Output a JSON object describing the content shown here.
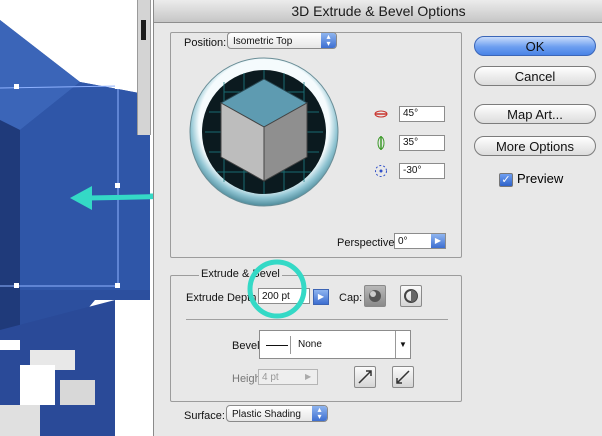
{
  "dialog": {
    "title": "3D Extrude & Bevel Options"
  },
  "position": {
    "label": "Position:",
    "preset": "Isometric Top",
    "x_rotation": "45°",
    "y_rotation": "35°",
    "z_rotation": "-30°",
    "perspective_label": "Perspective:",
    "perspective_value": "0°"
  },
  "extrude": {
    "group_label": "Extrude & Bevel",
    "depth_label": "Extrude Depth",
    "depth_value": "200 pt",
    "cap_label": "Cap:",
    "bevel_label": "Bevel:",
    "bevel_value": "None",
    "height_label": "Height:",
    "height_value": "4 pt"
  },
  "surface": {
    "label": "Surface:",
    "value": "Plastic Shading"
  },
  "buttons": {
    "ok": "OK",
    "cancel": "Cancel",
    "map_art": "Map Art...",
    "more_options": "More Options"
  },
  "preview": {
    "label": "Preview",
    "checked": true,
    "check_glyph": "✓"
  },
  "colors": {
    "accent": "#3f73d6",
    "cube_top": "#5e9bb1",
    "highlight": "#34d9c6",
    "art_blue": "#2c4f9e"
  }
}
